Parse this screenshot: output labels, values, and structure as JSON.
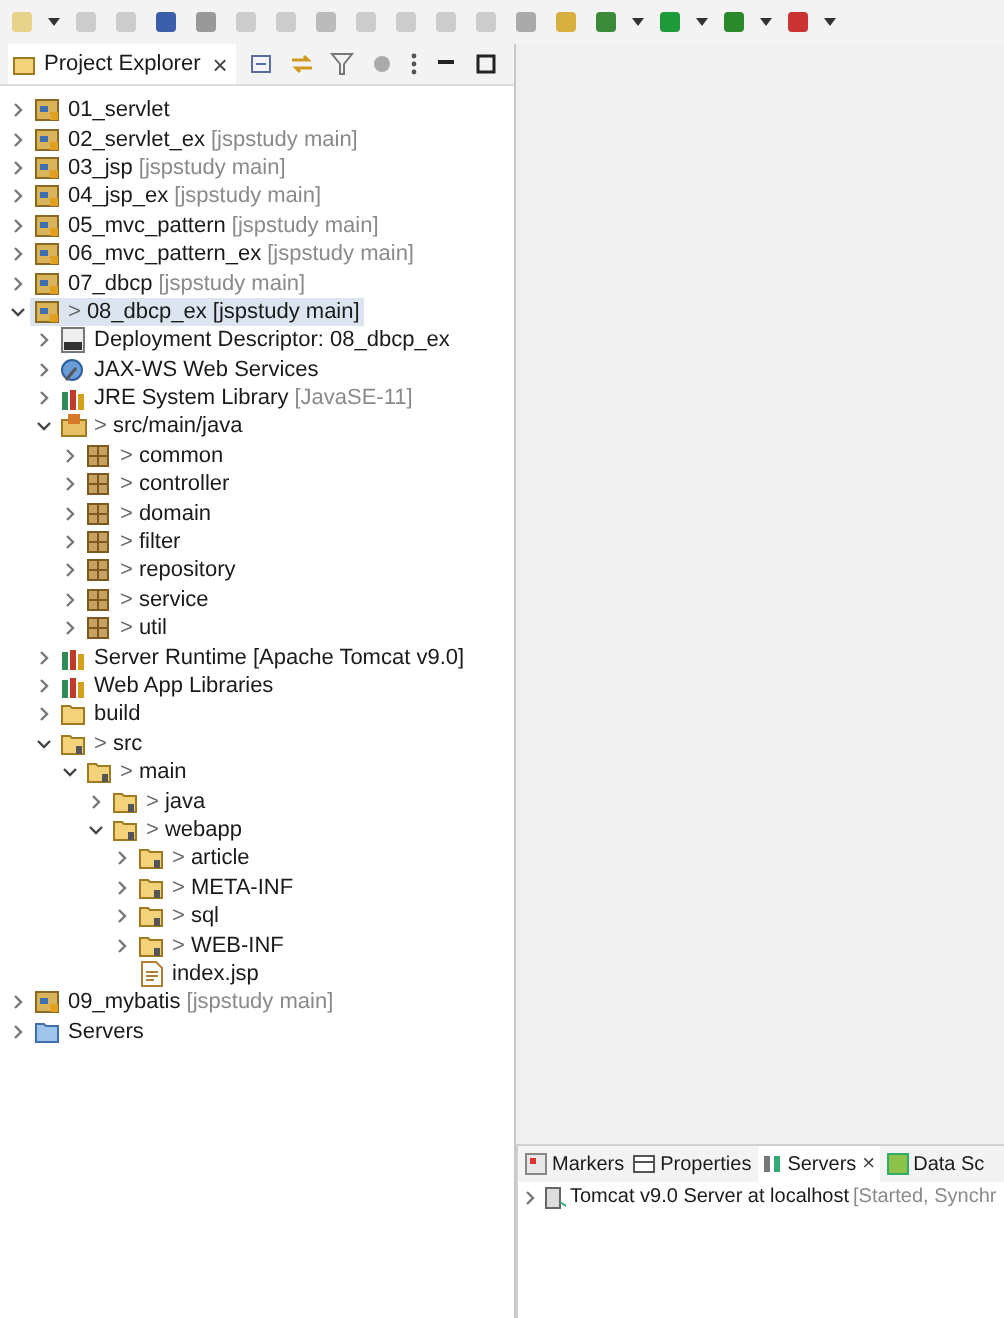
{
  "explorer": {
    "title": "Project Explorer",
    "close": "×",
    "tree": [
      {
        "kind": "project",
        "label": "01_servlet",
        "expanded": false,
        "selected": false
      },
      {
        "kind": "project",
        "label": "02_servlet_ex",
        "note": "[jspstudy main]",
        "expanded": false,
        "selected": false
      },
      {
        "kind": "project",
        "label": "03_jsp",
        "note": "[jspstudy main]",
        "expanded": false,
        "selected": false
      },
      {
        "kind": "project",
        "label": "04_jsp_ex",
        "note": "[jspstudy main]",
        "expanded": false,
        "selected": false
      },
      {
        "kind": "project",
        "label": "05_mvc_pattern",
        "note": "[jspstudy main]",
        "expanded": false,
        "selected": false
      },
      {
        "kind": "project",
        "label": "06_mvc_pattern_ex",
        "note": "[jspstudy main]",
        "expanded": false,
        "selected": false
      },
      {
        "kind": "project",
        "label": "07_dbcp",
        "note": "[jspstudy main]",
        "expanded": false,
        "selected": false
      },
      {
        "kind": "project",
        "prefix": ">",
        "label": "08_dbcp_ex [jspstudy main]",
        "expanded": true,
        "selected": true,
        "children": [
          {
            "kind": "descriptor",
            "label": "Deployment Descriptor: 08_dbcp_ex",
            "expanded": false,
            "selected": false
          },
          {
            "kind": "webservice",
            "label": "JAX-WS Web Services",
            "expanded": false,
            "selected": false
          },
          {
            "kind": "library",
            "label": "JRE System Library",
            "note": "[JavaSE-11]",
            "expanded": false,
            "selected": false
          },
          {
            "kind": "srcfolder",
            "prefix": ">",
            "label": "src/main/java",
            "expanded": true,
            "selected": false,
            "children": [
              {
                "kind": "package",
                "prefix": ">",
                "label": "common",
                "expanded": false,
                "selected": false
              },
              {
                "kind": "package",
                "prefix": ">",
                "label": "controller",
                "expanded": false,
                "selected": false
              },
              {
                "kind": "package",
                "prefix": ">",
                "label": "domain",
                "expanded": false,
                "selected": false
              },
              {
                "kind": "package",
                "prefix": ">",
                "label": "filter",
                "expanded": false,
                "selected": false
              },
              {
                "kind": "package",
                "prefix": ">",
                "label": "repository",
                "expanded": false,
                "selected": false
              },
              {
                "kind": "package",
                "prefix": ">",
                "label": "service",
                "expanded": false,
                "selected": false
              },
              {
                "kind": "package",
                "prefix": ">",
                "label": "util",
                "expanded": false,
                "selected": false
              }
            ]
          },
          {
            "kind": "library",
            "label": "Server Runtime [Apache Tomcat v9.0]",
            "expanded": false,
            "selected": false
          },
          {
            "kind": "library",
            "label": "Web App Libraries",
            "expanded": false,
            "selected": false
          },
          {
            "kind": "folder",
            "label": "build",
            "expanded": false,
            "selected": false
          },
          {
            "kind": "gitfolder",
            "prefix": ">",
            "label": "src",
            "expanded": true,
            "selected": false,
            "children": [
              {
                "kind": "gitfolder",
                "prefix": ">",
                "label": "main",
                "expanded": true,
                "selected": false,
                "children": [
                  {
                    "kind": "gitfolder",
                    "prefix": ">",
                    "label": "java",
                    "expanded": false,
                    "selected": false
                  },
                  {
                    "kind": "gitfolder",
                    "prefix": ">",
                    "label": "webapp",
                    "expanded": true,
                    "selected": false,
                    "children": [
                      {
                        "kind": "gitfolder",
                        "prefix": ">",
                        "label": "article",
                        "expanded": false,
                        "selected": false
                      },
                      {
                        "kind": "gitfolder",
                        "prefix": ">",
                        "label": "META-INF",
                        "expanded": false,
                        "selected": false
                      },
                      {
                        "kind": "gitfolder",
                        "prefix": ">",
                        "label": "sql",
                        "expanded": false,
                        "selected": false
                      },
                      {
                        "kind": "gitfolder",
                        "prefix": ">",
                        "label": "WEB-INF",
                        "expanded": false,
                        "selected": false
                      },
                      {
                        "kind": "file",
                        "label": "index.jsp",
                        "selected": false
                      }
                    ]
                  }
                ]
              }
            ]
          }
        ]
      },
      {
        "kind": "project",
        "label": "09_mybatis",
        "note": "[jspstudy main]",
        "expanded": false,
        "selected": false
      },
      {
        "kind": "servers",
        "label": "Servers",
        "expanded": false,
        "selected": false
      }
    ]
  },
  "bottom_panel": {
    "tabs": [
      {
        "kind": "markers",
        "label": "Markers",
        "selected": false
      },
      {
        "kind": "properties",
        "label": "Properties",
        "selected": false
      },
      {
        "kind": "servers",
        "label": "Servers",
        "selected": true,
        "close": "×"
      },
      {
        "kind": "datasource",
        "label": "Data Sc",
        "selected": false
      }
    ],
    "servers": [
      {
        "name": "Tomcat v9.0 Server at localhost",
        "status": "[Started, Synchr",
        "expanded": false
      }
    ]
  }
}
